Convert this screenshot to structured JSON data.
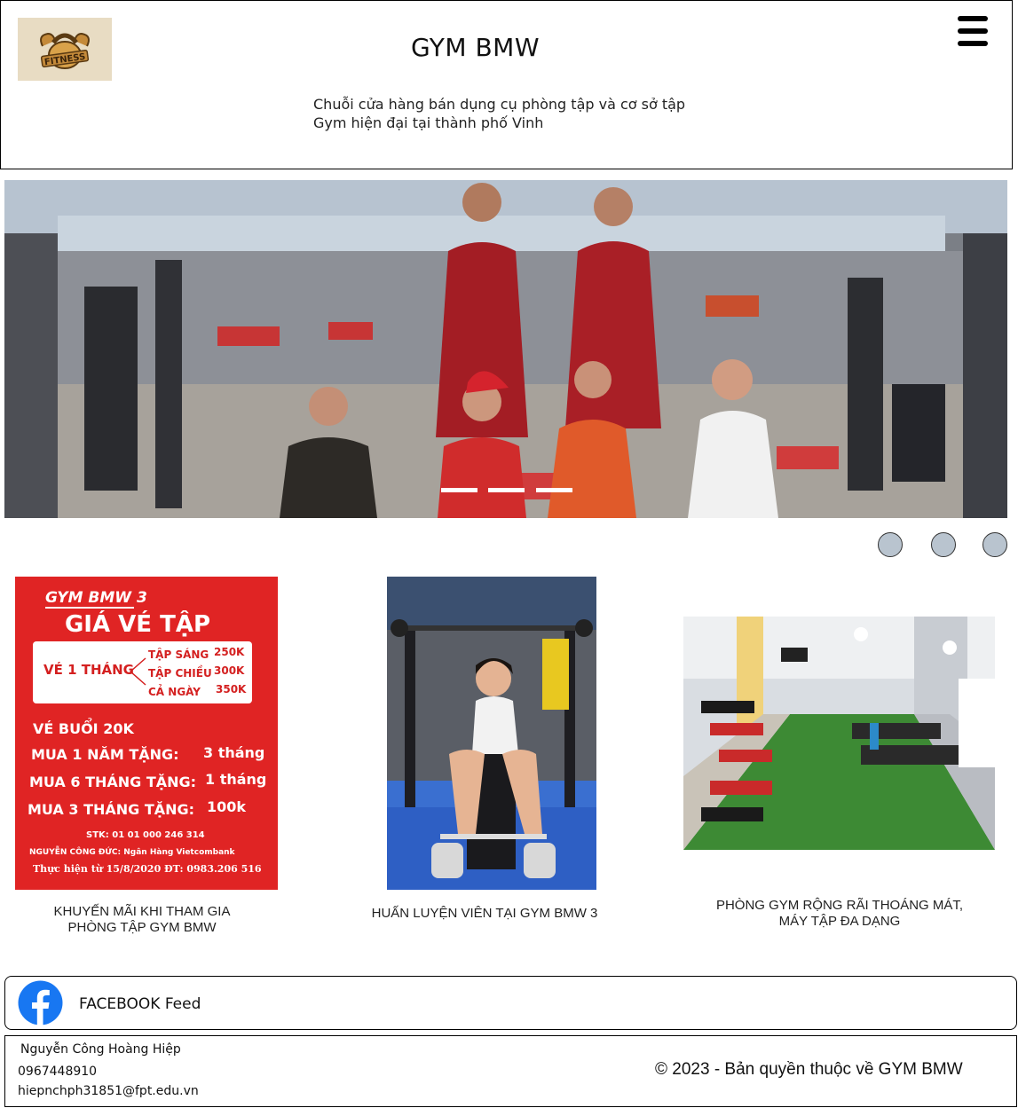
{
  "header": {
    "logo_text": "FITNESS",
    "title": "GYM BMW",
    "tagline": "Chuỗi cửa hàng bán dụng cụ phòng tập và cơ sở tập Gym hiện đại tại thành phố Vinh",
    "menu_icon": "hamburger-menu-icon"
  },
  "hero": {
    "slide_count": 3,
    "dot_count": 3
  },
  "cards": [
    {
      "caption": "KHUYẾN MÃI KHI THAM GIA PHÒNG TẬP GYM BMW",
      "poster": {
        "brand": "GYM BMW 3",
        "heading": "GIÁ VÉ TẬP",
        "monthly_label": "VÉ 1 THÁNG",
        "options": [
          {
            "name": "TẬP SÁNG",
            "price": "250K"
          },
          {
            "name": "TẬP CHIỀU",
            "price": "300K"
          },
          {
            "name": "CẢ NGÀY",
            "price": "350K"
          }
        ],
        "session": "VÉ BUỔI 20K",
        "promos": [
          {
            "label": "MUA 1 NĂM TẶNG:",
            "value": "3 tháng"
          },
          {
            "label": "MUA 6 THÁNG TẶNG:",
            "value": "1 tháng"
          },
          {
            "label": "MUA 3 THÁNG TẶNG:",
            "value": "100k"
          }
        ],
        "account": "STK: 01 01 000 246 314",
        "bank": "NGUYỄN CÔNG ĐỨC: Ngân Hàng Vietcombank",
        "effective": "Thực hiện từ 15/8/2020 ĐT: 0983.206 516"
      }
    },
    {
      "caption": "HUẤN LUYỆN VIÊN TẠI GYM BMW 3"
    },
    {
      "caption": "PHÒNG GYM RỘNG RÃI THOÁNG MÁT, MÁY TẬP ĐA DẠNG"
    }
  ],
  "facebook": {
    "icon": "facebook-icon",
    "label": "FACEBOOK Feed"
  },
  "footer": {
    "name": "Nguyễn Công Hoàng Hiệp",
    "phone": "0967448910",
    "email": "hiepnchph31851@fpt.edu.vn",
    "copyright": "© 2023 - Bản quyền thuộc về GYM BMW"
  },
  "colors": {
    "poster_red": "#e02424",
    "dot_fill": "#b9c4cf",
    "facebook_blue": "#1877f2",
    "logo_bg": "#e8dcc3"
  }
}
